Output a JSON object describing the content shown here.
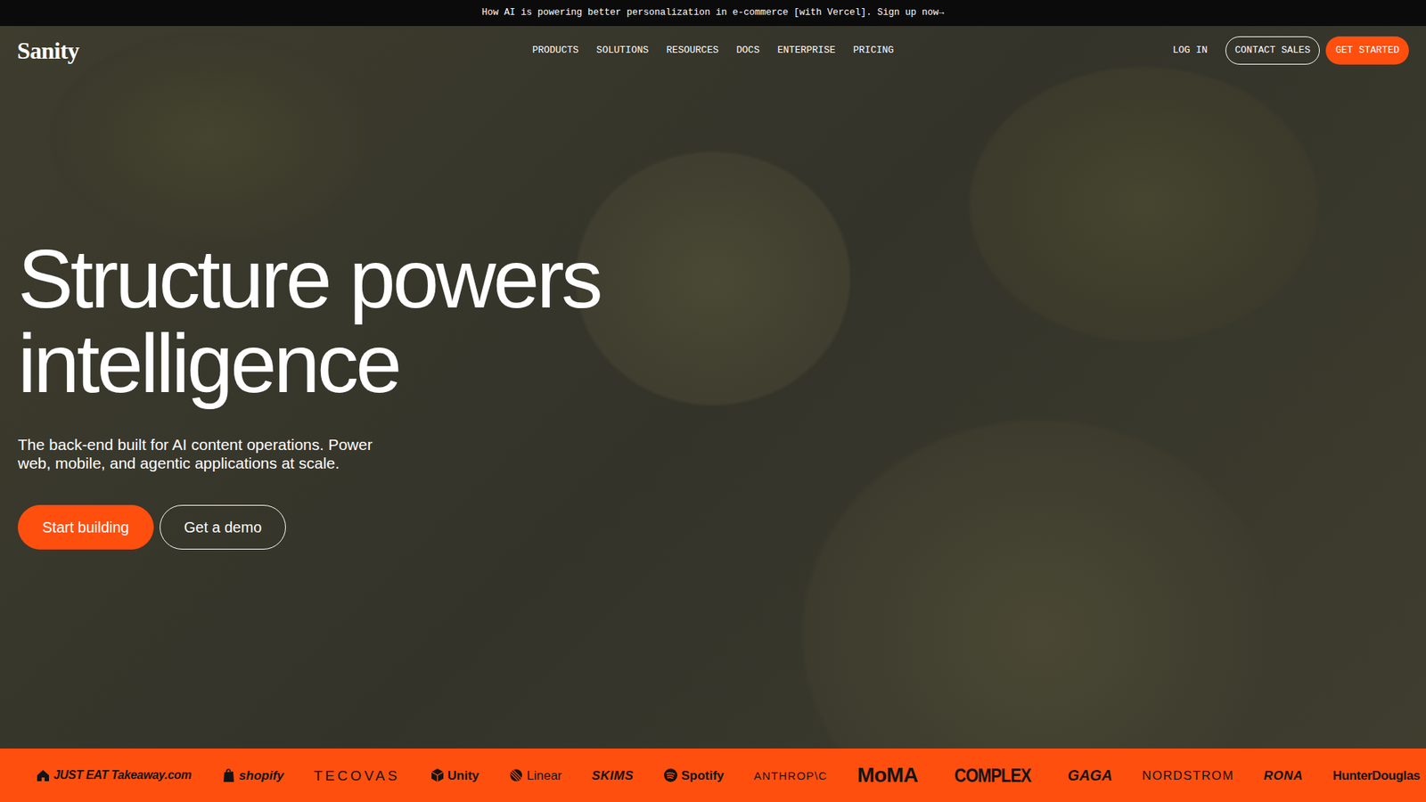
{
  "announcement": {
    "text": "How AI is powering better personalization in e-commerce [with Vercel]. Sign up now→"
  },
  "logo": "Sanity",
  "nav": {
    "links": [
      "PRODUCTS",
      "SOLUTIONS",
      "RESOURCES",
      "DOCS",
      "ENTERPRISE",
      "PRICING"
    ],
    "login": "LOG IN",
    "contact": "CONTACT SALES",
    "cta": "GET STARTED"
  },
  "hero": {
    "title": "Structure powers intelligence",
    "subtitle": "The back-end built for AI content operations. Power web, mobile, and agentic applications at scale.",
    "buttons": [
      "Start building",
      "Get a demo"
    ]
  },
  "customers": [
    "JUST EAT Takeaway.com",
    "shopify",
    "TECOVAS",
    "Unity",
    "Linear",
    "SKIMS",
    "Spotify",
    "ANTHROP\\C",
    "MoMA",
    "COMPLEX",
    "GAGA",
    "NORDSTROM",
    "RONA",
    "HunterDouglas"
  ]
}
